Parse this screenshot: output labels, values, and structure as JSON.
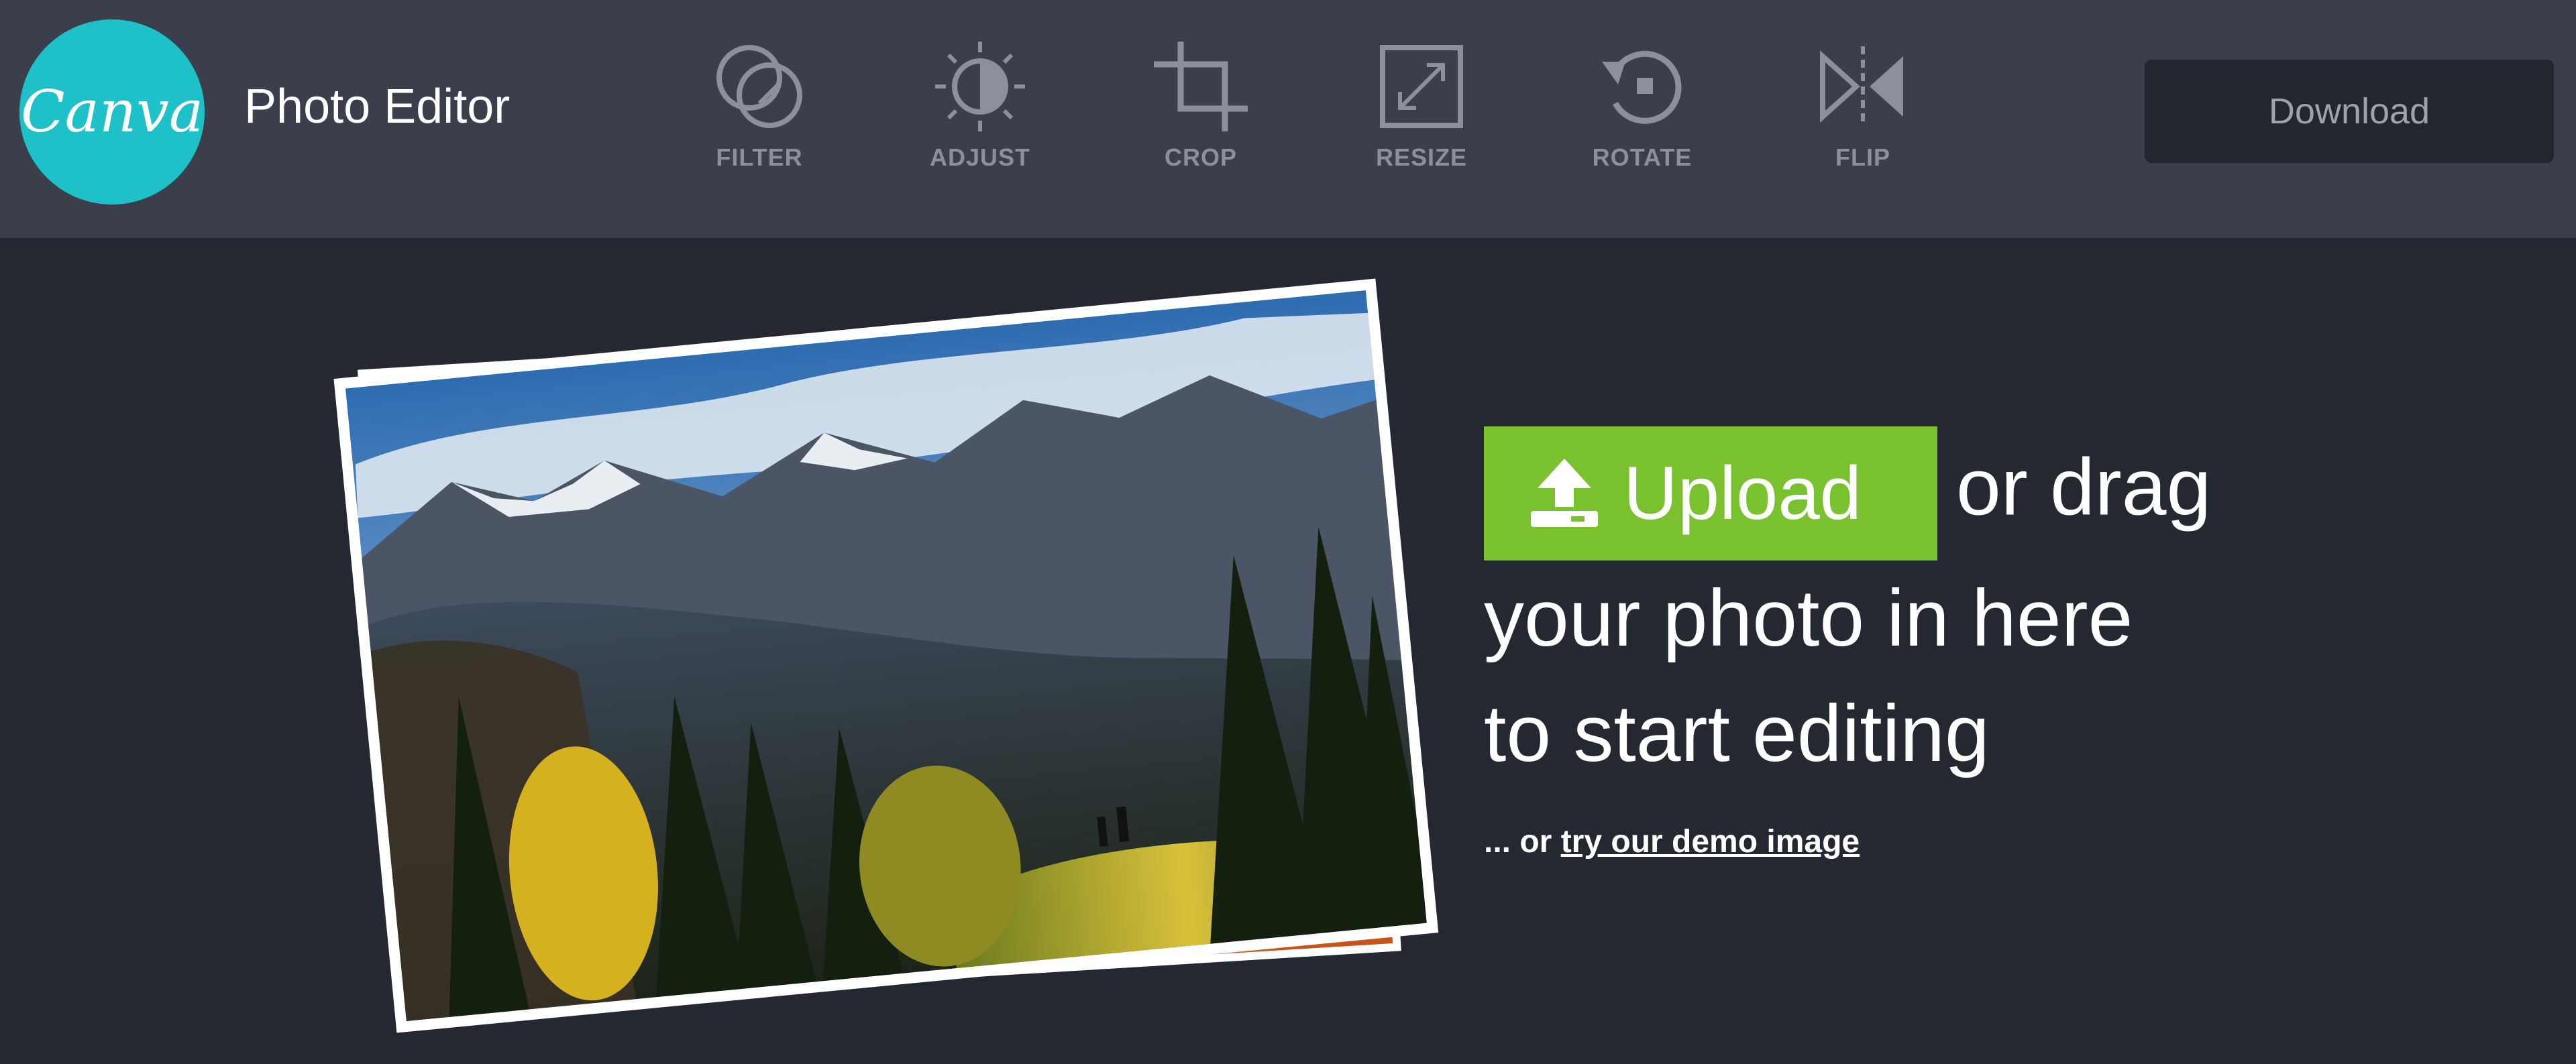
{
  "header": {
    "logo_text": "Canva",
    "app_title": "Photo Editor",
    "tools": [
      {
        "label": "FILTER",
        "icon": "filter-icon"
      },
      {
        "label": "ADJUST",
        "icon": "adjust-icon"
      },
      {
        "label": "CROP",
        "icon": "crop-icon"
      },
      {
        "label": "RESIZE",
        "icon": "resize-icon"
      },
      {
        "label": "ROTATE",
        "icon": "rotate-icon"
      },
      {
        "label": "FLIP",
        "icon": "flip-icon"
      }
    ],
    "download_label": "Download"
  },
  "main": {
    "upload_label": "Upload",
    "upload_icon": "upload-icon",
    "drag_text_1": "or drag",
    "drag_text_2": "your photo in here",
    "drag_text_3": "to start editing",
    "demo_prefix": "... or",
    "demo_link": "try our demo image"
  },
  "colors": {
    "background": "#242830",
    "topbar": "#3a3f4b",
    "brand": "#1fc1c9",
    "upload_green": "#7ac12f",
    "download_button": "#23262e"
  }
}
